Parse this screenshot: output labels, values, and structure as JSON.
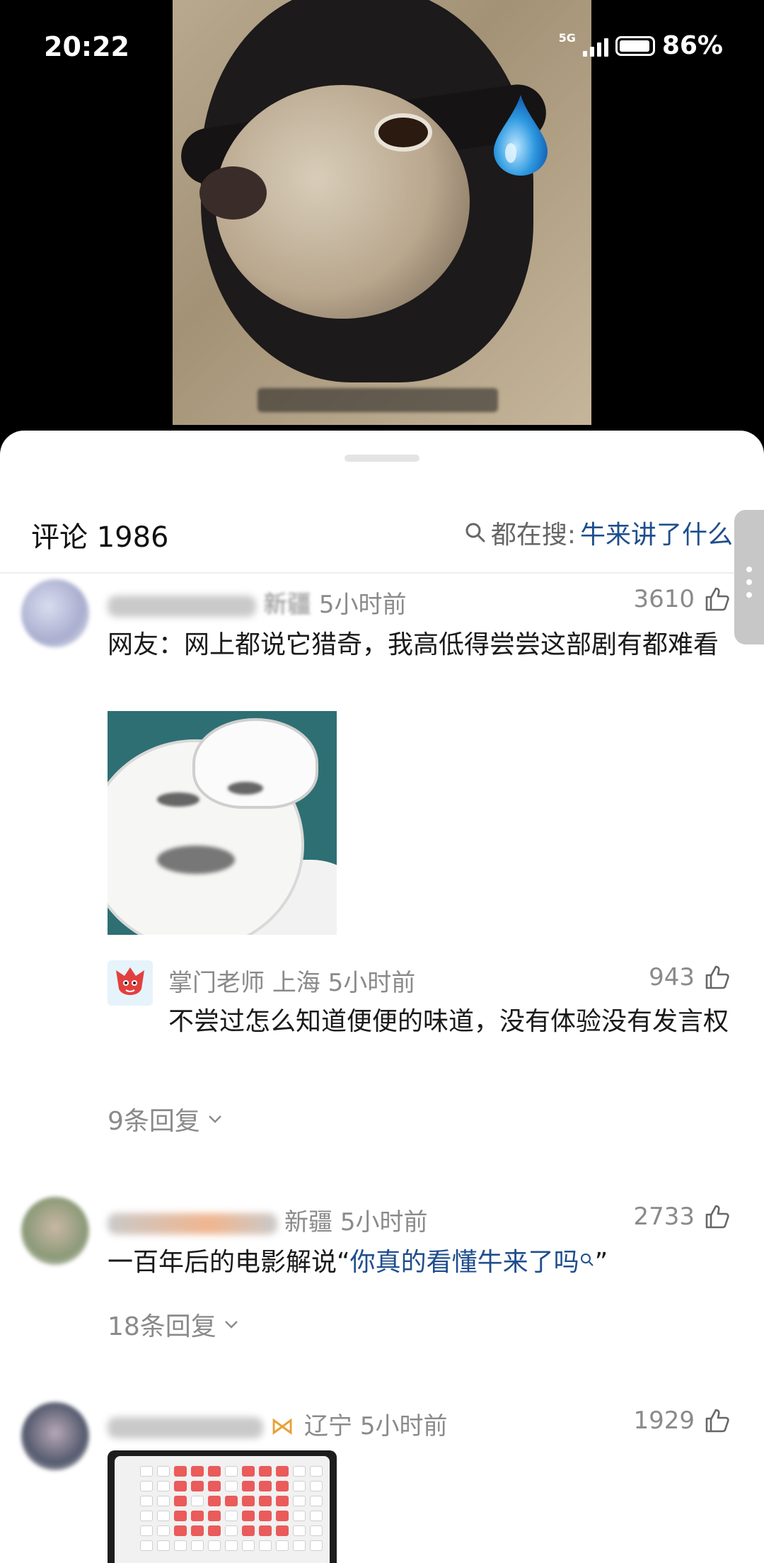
{
  "status_bar": {
    "time": "20:22",
    "network": "5G",
    "battery": "86%"
  },
  "video": {
    "icons": [
      "water-drop-icon"
    ]
  },
  "header": {
    "title": "评论 1986",
    "search_prefix": "都在搜:",
    "search_term": "牛来讲了什么"
  },
  "comments": [
    {
      "location": "新疆",
      "time": "5小时前",
      "likes": "3610",
      "text": "网友：网上都说它猎奇，我高低得尝尝这部剧有都难看",
      "reply": {
        "username": "掌门老师",
        "location": "上海",
        "time": "5小时前",
        "likes": "943",
        "text": "不尝过怎么知道便便的味道，没有体验没有发言权"
      },
      "replies_label": "9条回复"
    },
    {
      "location": "新疆",
      "time": "5小时前",
      "likes": "2733",
      "text_plain": "一百年后的电影解说“",
      "text_link": "你真的看懂牛来了吗",
      "text_close": "”",
      "replies_label": "18条回复"
    },
    {
      "location": "辽宁",
      "time": "5小时前",
      "likes": "1929"
    }
  ],
  "colors": {
    "link": "#1f4e8c",
    "meta": "#8a8a8a",
    "seat_sold": "#ea5b5b"
  }
}
